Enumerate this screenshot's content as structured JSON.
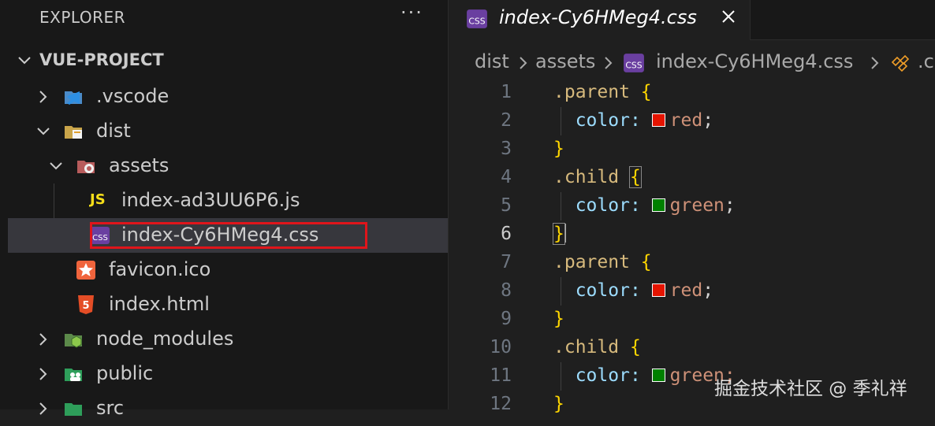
{
  "sidebar": {
    "title": "EXPLORER",
    "more": "···",
    "project": "VUE-PROJECT",
    "items": [
      {
        "label": ".vscode"
      },
      {
        "label": "dist"
      },
      {
        "label": "assets"
      },
      {
        "label": "index-ad3UU6P6.js"
      },
      {
        "label": "index-Cy6HMeg4.css"
      },
      {
        "label": "favicon.ico"
      },
      {
        "label": "index.html"
      },
      {
        "label": "node_modules"
      },
      {
        "label": "public"
      },
      {
        "label": "src"
      }
    ]
  },
  "tab": {
    "label": "index-Cy6HMeg4.css",
    "icon_text": "CSS"
  },
  "breadcrumbs": {
    "dist": "dist",
    "assets": "assets",
    "file": "index-Cy6HMeg4.css",
    "symbol": ".c"
  },
  "code": {
    "line_numbers": [
      "1",
      "2",
      "3",
      "4",
      "5",
      "6",
      "7",
      "8",
      "9",
      "10",
      "11",
      "12"
    ],
    "parent_sel": ".parent",
    "child_sel": ".child",
    "open_brace": "{",
    "close_brace": "}",
    "prop": "color:",
    "red": "red",
    "green": "green",
    "semi": ";",
    "green_partial": "green;"
  },
  "colors": {
    "red": "#e51400",
    "green": "#008000"
  },
  "watermark": "掘金技术社区 @ 季礼祥"
}
